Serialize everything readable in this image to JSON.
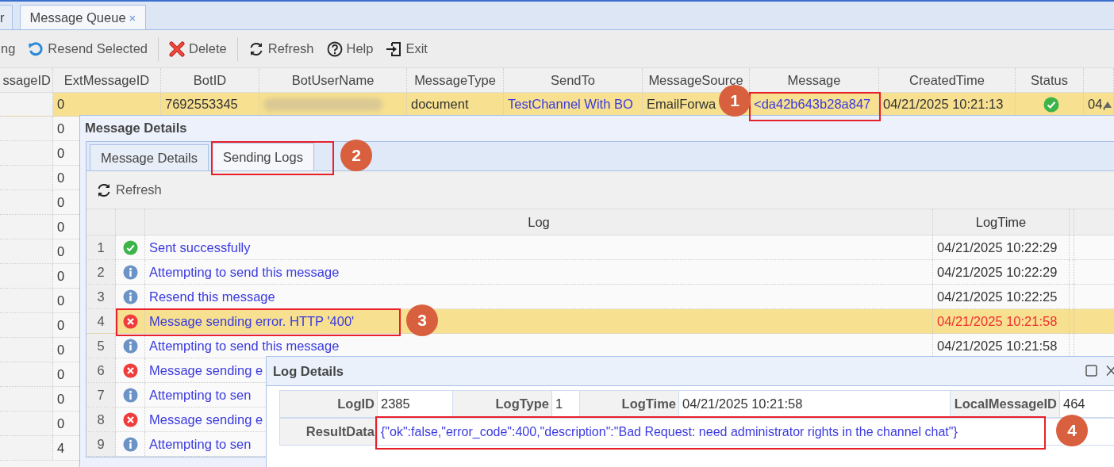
{
  "tabs": [
    {
      "label": "r",
      "selected": false
    },
    {
      "label": "Message Queue",
      "selected": true,
      "close": "×"
    }
  ],
  "toolbar": [
    {
      "kind": "plain",
      "label": "ng"
    },
    {
      "kind": "resend",
      "label": "Resend Selected"
    },
    {
      "kind": "separator"
    },
    {
      "kind": "delete",
      "label": "Delete"
    },
    {
      "kind": "separator"
    },
    {
      "kind": "refresh",
      "label": "Refresh"
    },
    {
      "kind": "help",
      "label": "Help"
    },
    {
      "kind": "exit",
      "label": "Exit"
    }
  ],
  "grid": {
    "columns": [
      "ssageID",
      "ExtMessageID",
      "BotID",
      "BotUserName",
      "MessageType",
      "SendTo",
      "MessageSource",
      "Message",
      "CreatedTime",
      "Status"
    ],
    "rows": [
      {
        "selected": true,
        "cells": [
          {
            "kind": "empty"
          },
          {
            "kind": "text",
            "text": "0"
          },
          {
            "kind": "text",
            "text": "7692553345"
          },
          {
            "kind": "redacted"
          },
          {
            "kind": "text",
            "text": "document"
          },
          {
            "kind": "link",
            "text": "TestChannel With BO"
          },
          {
            "kind": "text",
            "text": "EmailForwa"
          },
          {
            "kind": "link",
            "text": "<da42b643b28a847"
          },
          {
            "kind": "text",
            "text": "04/21/2025 10:21:13"
          },
          {
            "kind": "status_ok"
          },
          {
            "kind": "text",
            "text": "04,"
          }
        ]
      },
      {
        "selected": false,
        "cells": [
          {
            "kind": "empty"
          },
          {
            "kind": "text",
            "text": "0"
          }
        ]
      },
      {
        "selected": false,
        "cells": [
          {
            "kind": "empty"
          },
          {
            "kind": "text",
            "text": "0"
          }
        ]
      },
      {
        "selected": false,
        "cells": [
          {
            "kind": "empty"
          },
          {
            "kind": "text",
            "text": "0"
          }
        ]
      },
      {
        "selected": false,
        "cells": [
          {
            "kind": "empty"
          },
          {
            "kind": "text",
            "text": "0"
          }
        ]
      },
      {
        "selected": false,
        "cells": [
          {
            "kind": "empty"
          },
          {
            "kind": "text",
            "text": "0"
          }
        ]
      },
      {
        "selected": false,
        "cells": [
          {
            "kind": "empty"
          },
          {
            "kind": "text",
            "text": "0"
          }
        ]
      },
      {
        "selected": false,
        "cells": [
          {
            "kind": "empty"
          },
          {
            "kind": "text",
            "text": "0"
          }
        ]
      },
      {
        "selected": false,
        "cells": [
          {
            "kind": "empty"
          },
          {
            "kind": "text",
            "text": "0"
          }
        ]
      },
      {
        "selected": false,
        "cells": [
          {
            "kind": "empty"
          },
          {
            "kind": "text",
            "text": "0"
          }
        ]
      },
      {
        "selected": false,
        "cells": [
          {
            "kind": "empty"
          },
          {
            "kind": "text",
            "text": "0"
          }
        ]
      },
      {
        "selected": false,
        "cells": [
          {
            "kind": "empty"
          },
          {
            "kind": "text",
            "text": "0"
          }
        ]
      },
      {
        "selected": false,
        "cells": [
          {
            "kind": "empty"
          },
          {
            "kind": "text",
            "text": "0"
          }
        ]
      },
      {
        "selected": false,
        "cells": [
          {
            "kind": "empty"
          },
          {
            "kind": "text",
            "text": "0"
          }
        ]
      },
      {
        "selected": false,
        "cells": [
          {
            "kind": "empty"
          },
          {
            "kind": "text",
            "text": "4"
          }
        ]
      }
    ]
  },
  "message_details": {
    "title": "Message Details",
    "tabs": [
      {
        "label": "Message Details",
        "selected": false
      },
      {
        "label": "Sending Logs",
        "selected": true
      }
    ],
    "refresh": "Refresh",
    "columns": [
      "Log",
      "LogTime"
    ],
    "rows": [
      {
        "index": "1",
        "kind": "success",
        "log": "Sent successfully",
        "time": "04/21/2025 10:22:29",
        "selected": false
      },
      {
        "index": "2",
        "kind": "info",
        "log": "Attempting to send this message",
        "time": "04/21/2025 10:22:29",
        "selected": false
      },
      {
        "index": "3",
        "kind": "info",
        "log": "Resend this message",
        "time": "04/21/2025 10:22:25",
        "selected": false
      },
      {
        "index": "4",
        "kind": "error",
        "log": "Message sending error. HTTP '400'",
        "time": "04/21/2025 10:21:58",
        "selected": true
      },
      {
        "index": "5",
        "kind": "info",
        "log": "Attempting to send this message",
        "time": "04/21/2025 10:21:58",
        "selected": false
      },
      {
        "index": "6",
        "kind": "error",
        "log": "Message sending e",
        "selected": false
      },
      {
        "index": "7",
        "kind": "info",
        "log": "Attempting to sen",
        "selected": false
      },
      {
        "index": "8",
        "kind": "error",
        "log": "Message sending e",
        "selected": false
      },
      {
        "index": "9",
        "kind": "info",
        "log": "Attempting to sen",
        "selected": false
      }
    ]
  },
  "log_details": {
    "title": "Log Details",
    "fields": [
      {
        "label": "LogID",
        "value": "2385"
      },
      {
        "label": "LogType",
        "value": "1"
      },
      {
        "label": "LogTime",
        "value": "04/21/2025 10:21:58"
      },
      {
        "label": "LocalMessageID",
        "value": "464"
      }
    ],
    "result": {
      "label": "ResultData",
      "value": "{\"ok\":false,\"error_code\":400,\"description\":\"Bad Request: need administrator rights in the channel chat\"}"
    }
  },
  "annotations": [
    {
      "number": "1"
    },
    {
      "number": "2"
    },
    {
      "number": "3"
    },
    {
      "number": "4"
    }
  ]
}
